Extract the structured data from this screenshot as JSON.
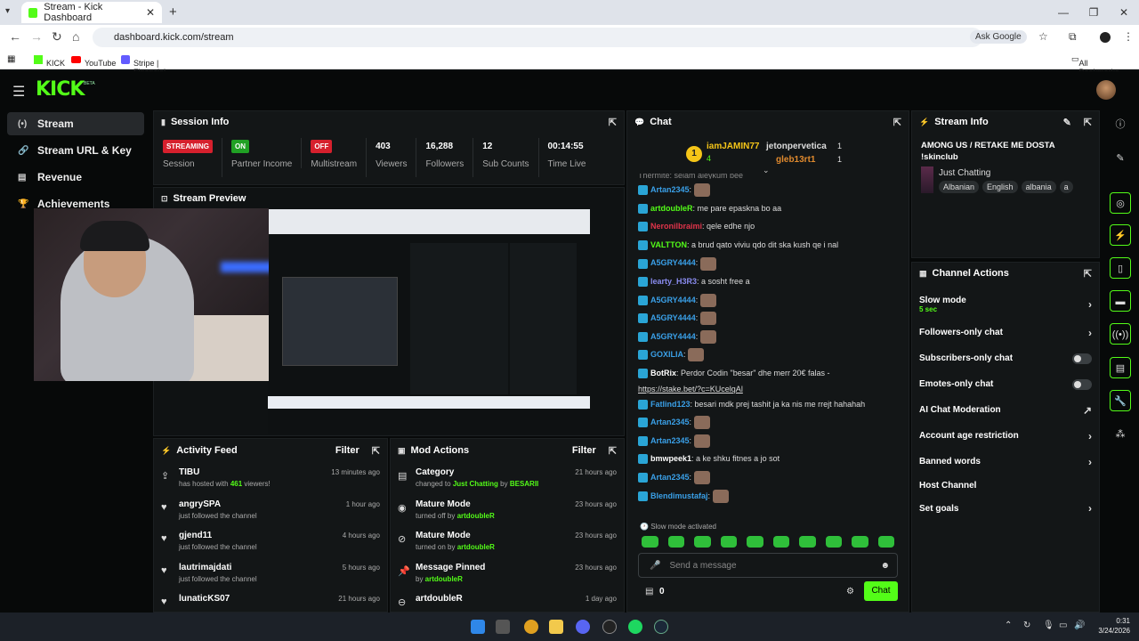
{
  "browser": {
    "tab_title": "Stream - Kick Dashboard",
    "url": "dashboard.kick.com/stream",
    "ask_google": "Ask Google",
    "bookmarks": [
      "KICK",
      "YouTube",
      "Stripe | Financial Infr..."
    ],
    "all_bookmarks": "All Bookmarks"
  },
  "app": {
    "logo": "KICK",
    "beta": "BETA",
    "sidebar": [
      {
        "label": "Stream",
        "icon": "broadcast-icon"
      },
      {
        "label": "Stream URL & Key",
        "icon": "link-icon"
      },
      {
        "label": "Revenue",
        "icon": "revenue-icon"
      },
      {
        "label": "Achievements",
        "icon": "trophy-icon"
      }
    ]
  },
  "session": {
    "title": "Session Info",
    "stats": [
      {
        "value": "STREAMING",
        "label": "Session",
        "badge_color": "#d6202d"
      },
      {
        "value": "ON",
        "label": "Partner Income",
        "badge_color": "#20a024"
      },
      {
        "value": "OFF",
        "label": "Multistream",
        "badge_color": "#d6202d"
      },
      {
        "value": "403",
        "label": "Viewers"
      },
      {
        "value": "16,288",
        "label": "Followers"
      },
      {
        "value": "12",
        "label": "Sub Counts"
      },
      {
        "value": "00:14:55",
        "label": "Time Live"
      }
    ]
  },
  "preview": {
    "title": "Stream Preview"
  },
  "activity": {
    "title": "Activity Feed",
    "filter": "Filter",
    "items": [
      {
        "name": "TIBU",
        "sub_pre": "has hosted with ",
        "sub_hl": "461",
        "sub_post": " viewers!",
        "time": "13 minutes ago",
        "icon": "host-icon"
      },
      {
        "name": "angrySPA",
        "sub_pre": "just followed the channel",
        "sub_hl": "",
        "sub_post": "",
        "time": "1 hour ago",
        "icon": "heart-icon"
      },
      {
        "name": "gjend11",
        "sub_pre": "just followed the channel",
        "sub_hl": "",
        "sub_post": "",
        "time": "4 hours ago",
        "icon": "heart-icon"
      },
      {
        "name": "lautrimajdati",
        "sub_pre": "just followed the channel",
        "sub_hl": "",
        "sub_post": "",
        "time": "5 hours ago",
        "icon": "heart-icon"
      },
      {
        "name": "lunaticKS07",
        "sub_pre": "",
        "sub_hl": "",
        "sub_post": "",
        "time": "21 hours ago",
        "icon": "heart-icon"
      }
    ]
  },
  "mod": {
    "title": "Mod Actions",
    "filter": "Filter",
    "items": [
      {
        "name": "Category",
        "sub_pre": "changed to ",
        "sub_hl": "Just Chatting",
        "sub_mid": " by ",
        "sub_hl2": "BESARII",
        "time": "21 hours ago",
        "icon": "category-icon"
      },
      {
        "name": "Mature Mode",
        "sub_pre": "turned off by ",
        "sub_hl": "artdoubleR",
        "sub_mid": "",
        "sub_hl2": "",
        "time": "23 hours ago",
        "icon": "eye-icon"
      },
      {
        "name": "Mature Mode",
        "sub_pre": "turned on by ",
        "sub_hl": "artdoubleR",
        "sub_mid": "",
        "sub_hl2": "",
        "time": "23 hours ago",
        "icon": "eye-off-icon"
      },
      {
        "name": "Message Pinned",
        "sub_pre": "by ",
        "sub_hl": "artdoubleR",
        "sub_mid": "",
        "sub_hl2": "",
        "time": "23 hours ago",
        "icon": "pin-icon"
      },
      {
        "name": "artdoubleR",
        "sub_pre": "",
        "sub_hl": "",
        "sub_mid": "",
        "sub_hl2": "",
        "time": "1 day ago",
        "icon": "ban-icon"
      }
    ]
  },
  "chat": {
    "title": "Chat",
    "top_gifter": {
      "rank": "1",
      "name": "iamJAMIN77",
      "count": "4"
    },
    "gifters": [
      {
        "name": "jetonpervetica",
        "count": "1"
      },
      {
        "name": "gleb13rt1",
        "count": "1"
      }
    ],
    "cut_line": "Thermite: selam aleykum bee",
    "messages": [
      {
        "user": "Artan2345",
        "color": "#3aa0e8",
        "text": "",
        "emote": true
      },
      {
        "user": "artdoubleR",
        "color": "#53fc18",
        "text": "me pare epaskna bo aa",
        "emote": false
      },
      {
        "user": "Neronilbraimi",
        "color": "#e0344a",
        "text": "qele edhe njo",
        "emote": false
      },
      {
        "user": "VALTTON",
        "color": "#53fc18",
        "text": "a brud qato viviu qdo dit ska kush qe i nal",
        "emote": false
      },
      {
        "user": "A5GRY4444",
        "color": "#3aa0e8",
        "text": "",
        "emote": true
      },
      {
        "user": "learty_H3R3",
        "color": "#8a8cf0",
        "text": "a sosht free a",
        "emote": false
      },
      {
        "user": "A5GRY4444",
        "color": "#3aa0e8",
        "text": "",
        "emote": true
      },
      {
        "user": "A5GRY4444",
        "color": "#3aa0e8",
        "text": "",
        "emote": true
      },
      {
        "user": "A5GRY4444",
        "color": "#3aa0e8",
        "text": "",
        "emote": true
      },
      {
        "user": "GOXILIA",
        "color": "#3aa0e8",
        "text": "",
        "emote": true
      },
      {
        "user": "BotRix",
        "color": "#ffffff",
        "text": "Perdor Codin \"besar\" dhe merr 20€ falas -",
        "emote": false
      },
      {
        "user": "",
        "color": "#ffffff",
        "text": "https://stake.bet/?c=KUcelqAl",
        "emote": false
      },
      {
        "user": "Fatlind123",
        "color": "#3aa0e8",
        "text": "besari mdk prej tashit ja ka nis me rrejt hahahah",
        "emote": false
      },
      {
        "user": "Artan2345",
        "color": "#3aa0e8",
        "text": "",
        "emote": true
      },
      {
        "user": "Artan2345",
        "color": "#3aa0e8",
        "text": "",
        "emote": true
      },
      {
        "user": "bmwpeek1",
        "color": "#ffffff",
        "text": "a ke shku fitnes a jo sot",
        "emote": false
      },
      {
        "user": "Artan2345",
        "color": "#3aa0e8",
        "text": "",
        "emote": true
      },
      {
        "user": "Blendimustafaj",
        "color": "#3aa0e8",
        "text": "",
        "emote": true
      }
    ],
    "slow_mode_note": "Slow mode activated",
    "input_placeholder": "Send a message",
    "kicks": "0",
    "send": "Chat"
  },
  "stream_info": {
    "title": "Stream Info",
    "stream_title": "AMONG US / RETAKE ME DOSTA !skinclub",
    "category": "Just Chatting",
    "tags": [
      "Albanian",
      "English",
      "albania",
      "a"
    ]
  },
  "channel_actions": {
    "title": "Channel Actions",
    "items": [
      {
        "label": "Slow mode",
        "sub": "5 sec",
        "control": "arrow"
      },
      {
        "label": "Followers-only chat",
        "sub": "",
        "control": "arrow"
      },
      {
        "label": "Subscribers-only chat",
        "sub": "",
        "control": "toggle"
      },
      {
        "label": "Emotes-only chat",
        "sub": "",
        "control": "toggle"
      },
      {
        "label": "AI Chat Moderation",
        "sub": "",
        "control": "external"
      },
      {
        "label": "Account age restriction",
        "sub": "",
        "control": "arrow"
      },
      {
        "label": "Banned words",
        "sub": "",
        "control": "arrow"
      },
      {
        "label": "Host Channel",
        "sub": "",
        "control": "none"
      },
      {
        "label": "Set goals",
        "sub": "",
        "control": "arrow"
      }
    ]
  },
  "taskbar": {
    "time": "0:31",
    "date": "3/24/2026"
  },
  "colors": {
    "accent": "#53fc18",
    "bg": "#070909",
    "panel": "#131617"
  }
}
